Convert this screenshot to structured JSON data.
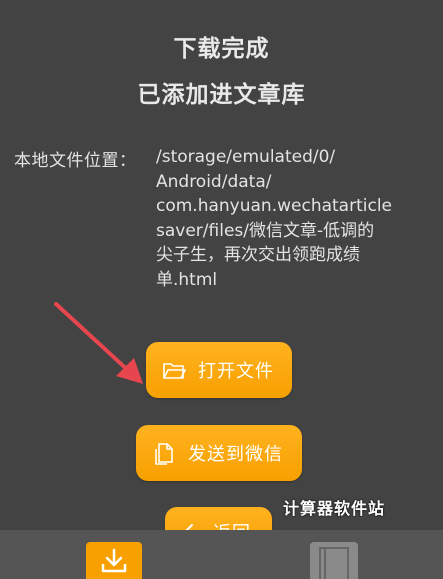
{
  "header": {
    "title": "下载完成",
    "subtitle": "已添加进文章库"
  },
  "file_location": {
    "label": "本地文件位置：",
    "lines": [
      "/storage/emulated/0/",
      "Android/data/",
      "com.hanyuan.wechatarticle",
      "saver/files/微信文章-低调的",
      "尖子生，再次交出领跑成绩",
      "单.html"
    ]
  },
  "buttons": {
    "open_file": "打开文件",
    "send_wechat": "发送到微信",
    "back": "返回"
  },
  "watermark": "计算器软件站",
  "colors": {
    "background": "#434343",
    "accent": "#f7a000",
    "arrow": "#e8464f",
    "bottom_bar": "#555555"
  },
  "icons": {
    "open_file": "folder-open-icon",
    "send_wechat": "document-icon",
    "back": "chevron-left-icon",
    "bottom_left": "download-icon",
    "bottom_right": "book-icon"
  }
}
